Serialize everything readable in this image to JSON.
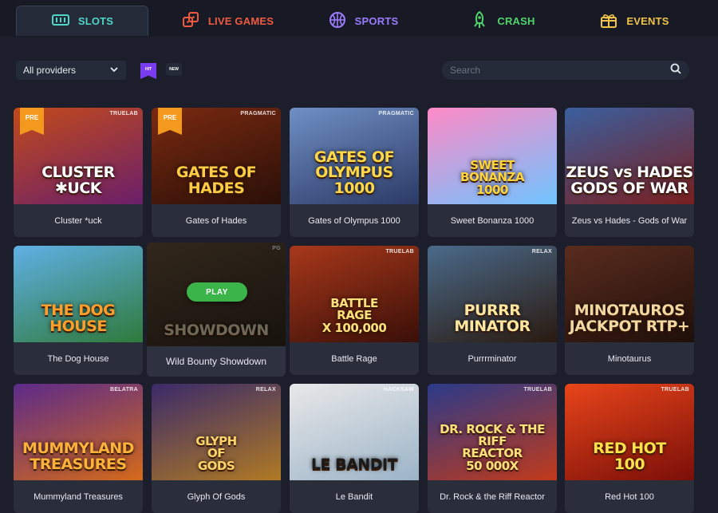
{
  "nav": {
    "tabs": [
      {
        "label": "SLOTS",
        "icon": "slots-icon",
        "color": "#4fd6c7",
        "active": true
      },
      {
        "label": "LIVE GAMES",
        "icon": "dice-icon",
        "color": "#ef5a40"
      },
      {
        "label": "SPORTS",
        "icon": "basketball-icon",
        "color": "#9b7cff"
      },
      {
        "label": "CRASH",
        "icon": "rocket-icon",
        "color": "#52d46c"
      },
      {
        "label": "EVENTS",
        "icon": "gift-icon",
        "color": "#f1c34b"
      }
    ]
  },
  "filters": {
    "provider": "All providers",
    "hit_label": "HIT",
    "new_label": "NEW",
    "search_placeholder": "Search"
  },
  "games": [
    {
      "name": "Cluster *uck",
      "art": "CLUSTER\n✱UCK",
      "badge": "PRE",
      "provider": "TRUELAB",
      "bg": [
        "#c24a1a",
        "#6a1f6a"
      ],
      "artColor": "#ffffff"
    },
    {
      "name": "Gates of Hades",
      "art": "GATES OF\nHADES",
      "badge": "PRE",
      "provider": "PRAGMATIC",
      "bg": [
        "#7a2a10",
        "#2a0f08"
      ],
      "artColor": "#ffcc44"
    },
    {
      "name": "Gates of Olympus 1000",
      "art": "GATES OF OLYMPUS\n1000",
      "provider": "PRAGMATIC",
      "bg": [
        "#6f8fc4",
        "#2c3a66"
      ],
      "artColor": "#ffd84a"
    },
    {
      "name": "Sweet Bonanza 1000",
      "art": "SWEET\nBONANZA\n1000",
      "provider": "",
      "bg": [
        "#ff8ac6",
        "#6fc3ff"
      ],
      "artColor": "#ffd43b"
    },
    {
      "name": "Zeus vs Hades - Gods of War",
      "art": "ZEUS vs HADES\nGODS OF WAR",
      "provider": "",
      "bg": [
        "#3a5f9e",
        "#7a1f1f"
      ],
      "artColor": "#ffffff"
    },
    {
      "name": "The Dog House",
      "art": "THE DOG\nHOUSE",
      "provider": "",
      "bg": [
        "#5fb0e6",
        "#2f7a3b"
      ],
      "artColor": "#ff9f2a"
    },
    {
      "name": "Wild Bounty Showdown",
      "art": "SHOWDOWN",
      "provider": "PG",
      "bg": [
        "#5a4632",
        "#2a2218"
      ],
      "artColor": "#cdbb9a",
      "hover": true,
      "play_label": "PLAY"
    },
    {
      "name": "Battle Rage",
      "art": "BATTLE\nRAGE\nX 100,000",
      "provider": "TRUELAB",
      "bg": [
        "#a8381a",
        "#3a0f08"
      ],
      "artColor": "#ffe07a"
    },
    {
      "name": "Purrrminator",
      "art": "PURRR\nMINATOR",
      "provider": "RELAX",
      "bg": [
        "#4a6a8a",
        "#2a1a10"
      ],
      "artColor": "#ffe6a0"
    },
    {
      "name": "Minotaurus",
      "art": "MINOTAUROS\nJACKPOT RTP+",
      "provider": "",
      "bg": [
        "#5a2c1e",
        "#1f0f0a"
      ],
      "artColor": "#f3d7a0"
    },
    {
      "name": "Mummyland Treasures",
      "art": "MUMMYLAND\nTREASURES",
      "provider": "BELATRA",
      "bg": [
        "#5c2a8a",
        "#d46a1a"
      ],
      "artColor": "#ffb23a"
    },
    {
      "name": "Glyph Of Gods",
      "art": "GLYPH\nOF\nGODS",
      "provider": "RELAX",
      "bg": [
        "#3a2a6a",
        "#b07a24"
      ],
      "artColor": "#ffd36a"
    },
    {
      "name": "Le Bandit",
      "art": "LE BANDIT",
      "provider": "HACKSAW",
      "bg": [
        "#e8e8e8",
        "#9cb4c8"
      ],
      "artColor": "#1a1a1a"
    },
    {
      "name": "Dr. Rock & the Riff Reactor",
      "art": "DR. ROCK & THE RIFF\nREACTOR\n50 000X",
      "provider": "TRUELAB",
      "bg": [
        "#2a3a8a",
        "#c23a1a"
      ],
      "artColor": "#ffe07a"
    },
    {
      "name": "Red Hot 100",
      "art": "RED HOT\n100",
      "provider": "TRUELAB",
      "bg": [
        "#e8451a",
        "#7a0f08"
      ],
      "artColor": "#ffe14a"
    }
  ]
}
